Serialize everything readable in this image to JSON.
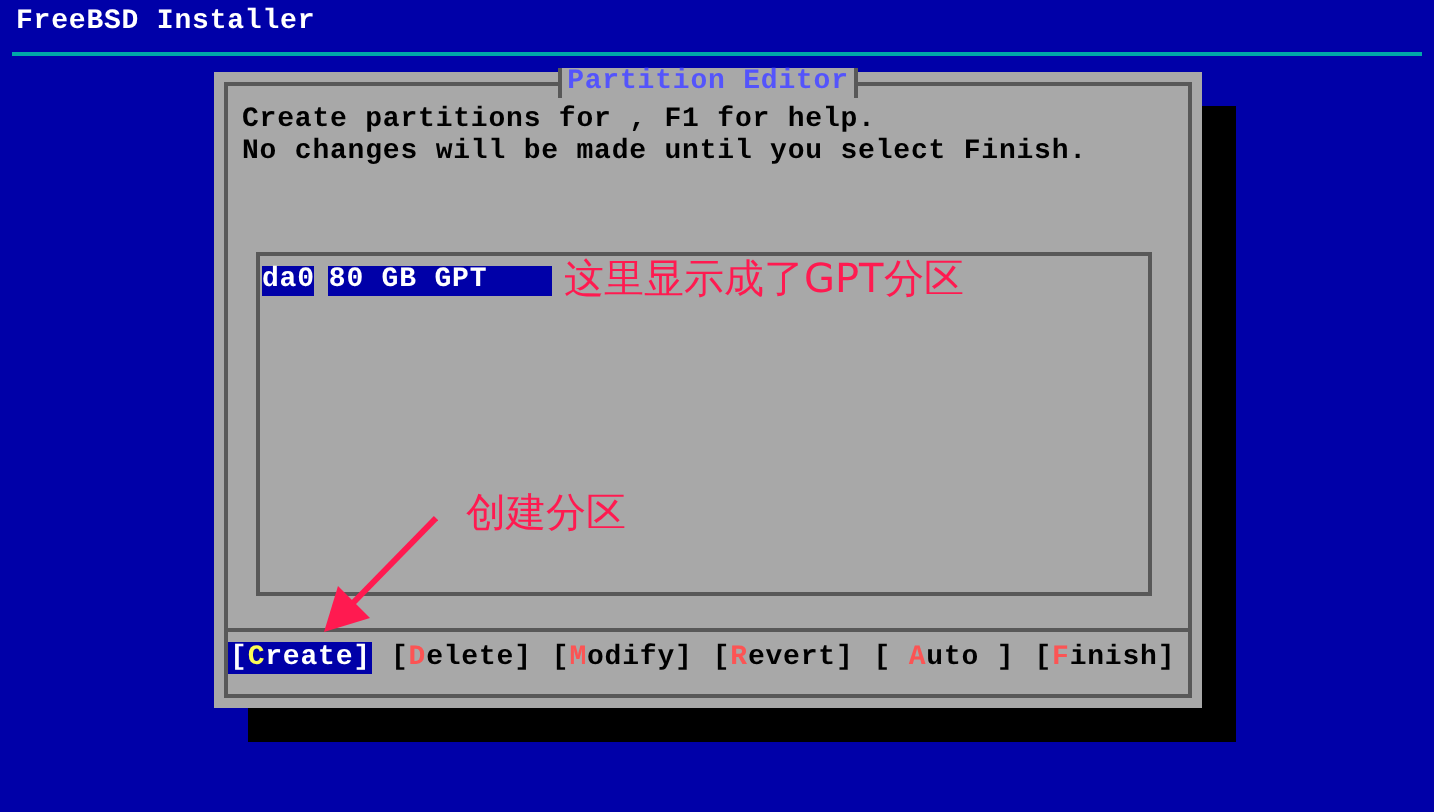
{
  "window": {
    "title": "FreeBSD Installer"
  },
  "dialog": {
    "title": "Partition Editor",
    "message": [
      "Create partitions for , F1 for help.",
      "No changes will be made until you select Finish."
    ],
    "partitions": [
      {
        "name": "da0",
        "info": "80 GB GPT",
        "selected": true
      }
    ],
    "buttons": [
      {
        "before": "[",
        "key": "C",
        "after": "reate]",
        "selected": true
      },
      {
        "before": "[",
        "key": "D",
        "after": "elete]",
        "selected": false
      },
      {
        "before": "[",
        "key": "M",
        "after": "odify]",
        "selected": false
      },
      {
        "before": "[",
        "key": "R",
        "after": "evert]",
        "selected": false
      },
      {
        "before": "[ ",
        "key": "A",
        "after": "uto ]",
        "selected": false
      },
      {
        "before": "[",
        "key": "F",
        "after": "inish]",
        "selected": false
      }
    ]
  },
  "annotations": [
    {
      "kind": "note",
      "text": "这里显示成了GPT分区"
    },
    {
      "kind": "arrow-note",
      "text": "创建分区"
    }
  ]
}
